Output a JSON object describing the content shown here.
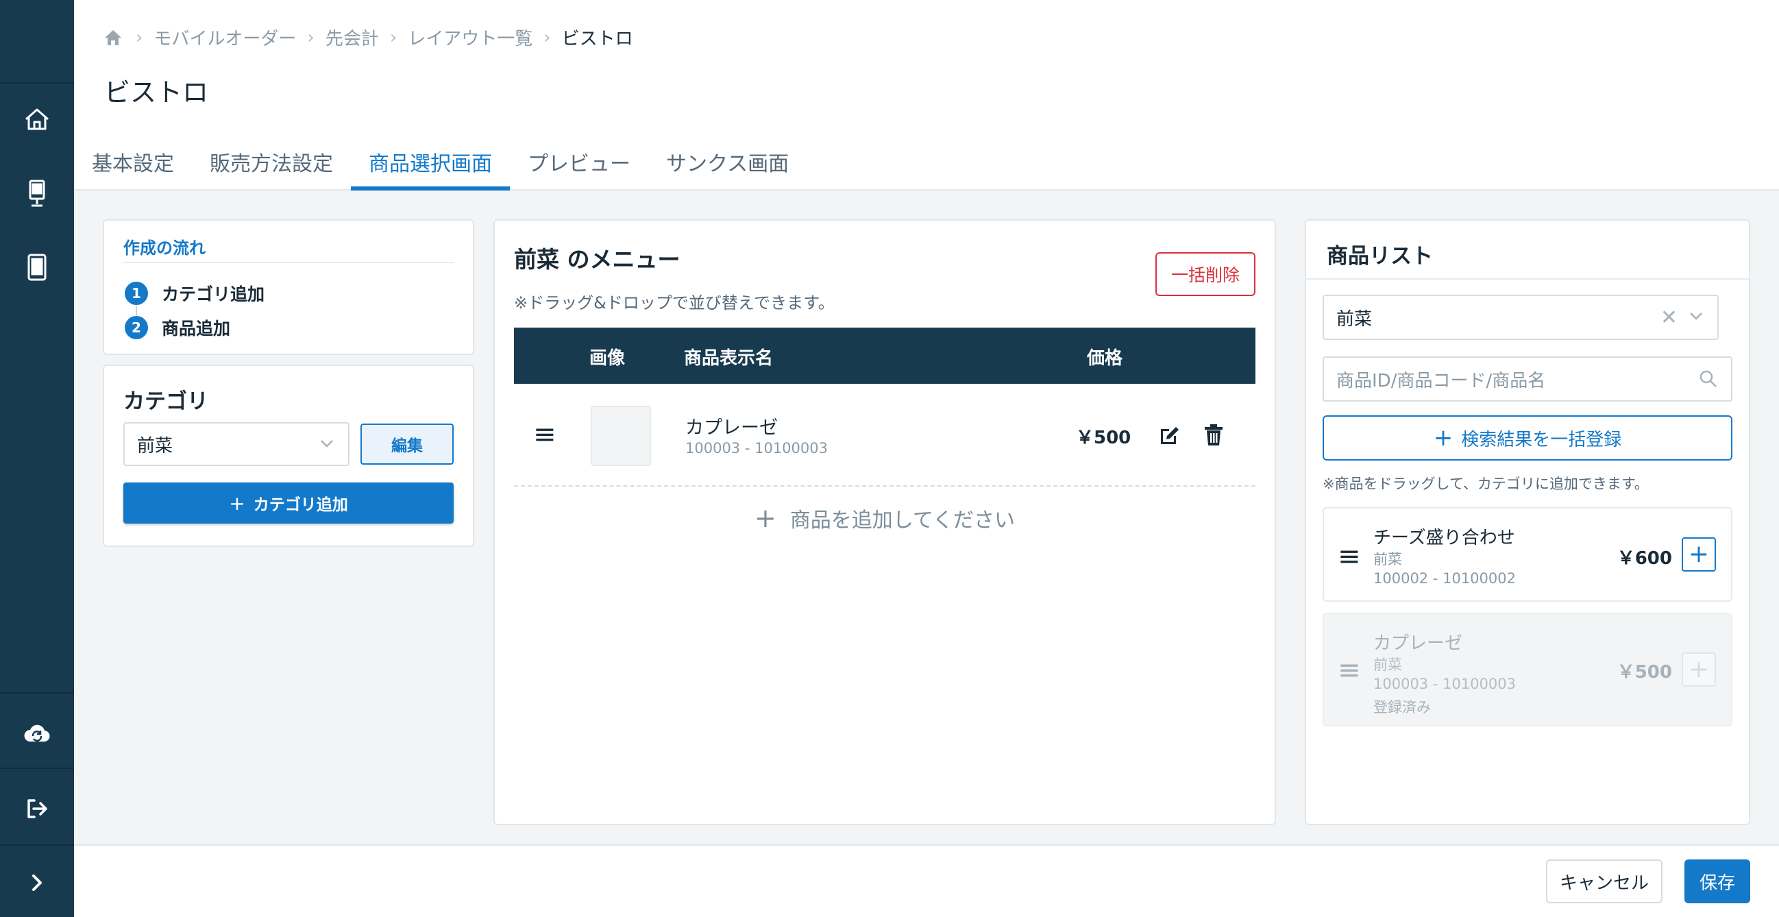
{
  "sidebar": {
    "icons": [
      "home-icon",
      "kiosk-icon",
      "tablet-icon",
      "cloud-sync-icon",
      "logout-icon",
      "chevron-right-icon"
    ]
  },
  "breadcrumb": {
    "items": [
      "モバイルオーダー",
      "先会計",
      "レイアウト一覧"
    ],
    "current": "ビストロ"
  },
  "page_title": "ビストロ",
  "tabs": [
    "基本設定",
    "販売方法設定",
    "商品選択画面",
    "プレビュー",
    "サンクス画面"
  ],
  "active_tab": "商品選択画面",
  "flow": {
    "title": "作成の流れ",
    "steps": [
      {
        "num": "1",
        "label": "カテゴリ追加"
      },
      {
        "num": "2",
        "label": "商品追加"
      }
    ]
  },
  "category": {
    "title": "カテゴリ",
    "selected": "前菜",
    "edit_label": "編集",
    "add_label": "カテゴリ追加"
  },
  "menu": {
    "title": "前菜 のメニュー",
    "note": "※ドラッグ&ドロップで並び替えできます。",
    "bulk_delete_label": "一括削除",
    "columns": {
      "image": "画像",
      "name": "商品表示名",
      "price": "価格"
    },
    "rows": [
      {
        "name": "カプレーゼ",
        "code": "100003 - 10100003",
        "price": "￥500"
      }
    ],
    "add_label": "商品を追加してください"
  },
  "product_list": {
    "title": "商品リスト",
    "category_filter": "前菜",
    "search_placeholder": "商品ID/商品コード/商品名",
    "bulk_register_label": "検索結果を一括登録",
    "note": "※商品をドラッグして、カテゴリに追加できます。",
    "items": [
      {
        "name": "チーズ盛り合わせ",
        "category": "前菜",
        "code": "100002 - 10100002",
        "price": "￥600",
        "status": "",
        "disabled": false
      },
      {
        "name": "カプレーゼ",
        "category": "前菜",
        "code": "100003 - 10100003",
        "price": "￥500",
        "status": "登録済み",
        "disabled": true
      }
    ]
  },
  "footer": {
    "cancel_label": "キャンセル",
    "save_label": "保存"
  },
  "colors": {
    "sidebar": "#173a4f",
    "accent": "#1479c9",
    "danger": "#d9313a"
  }
}
